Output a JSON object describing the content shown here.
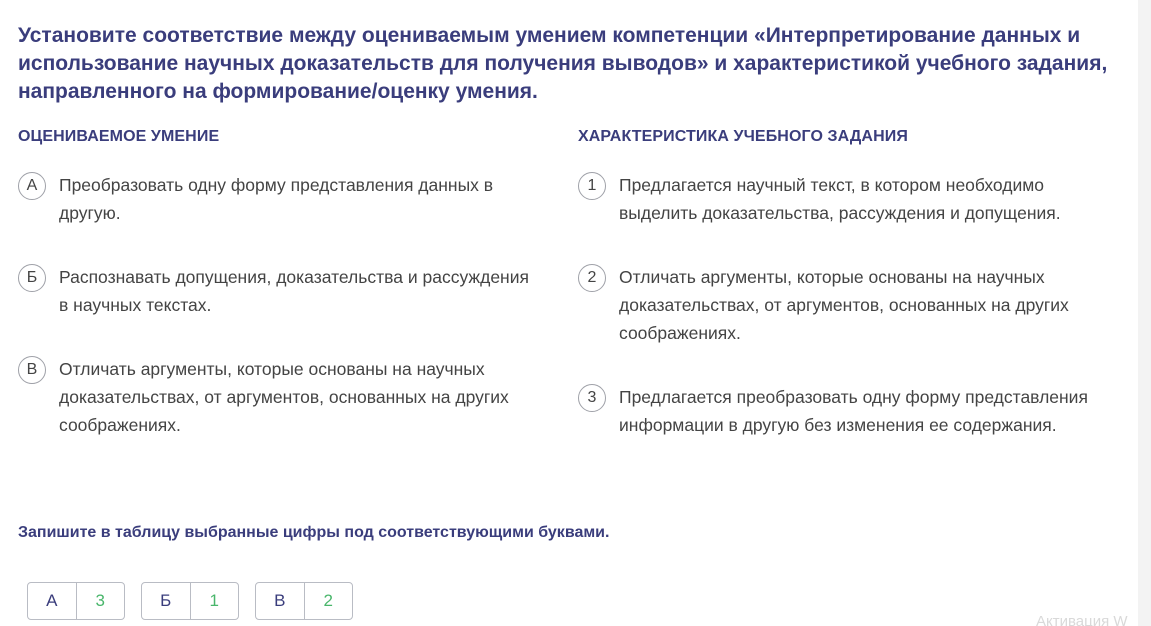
{
  "question": "Установите соответствие между оцениваемым умением компетенции «Интерпретирование данных и использование научных доказательств для получения выводов» и характеристикой учебного задания, направленного на формирование/оценку умения.",
  "left_header": "ОЦЕНИВАЕМОЕ УМЕНИЕ",
  "right_header": "ХАРАКТЕРИСТИКА УЧЕБНОГО ЗАДАНИЯ",
  "left_items": [
    {
      "marker": "А",
      "text": "Преобразовать одну форму представления данных в другую."
    },
    {
      "marker": "Б",
      "text": "Распознавать допущения, доказательства и рассуждения в научных текстах."
    },
    {
      "marker": "В",
      "text": "Отличать аргументы, которые основаны на научных доказательствах, от аргументов, основанных на других соображениях."
    }
  ],
  "right_items": [
    {
      "marker": "1",
      "text": "Предлагается научный текст, в котором необходимо выделить доказательства, рассуждения и допущения."
    },
    {
      "marker": "2",
      "text": "Отличать аргументы, которые основаны на научных доказательствах, от аргументов, основанных на других соображениях."
    },
    {
      "marker": "3",
      "text": "Предлагается преобразовать одну форму представления информации в другую без изменения ее содержания."
    }
  ],
  "instruction": "Запишите в таблицу выбранные цифры под соответствующими буквами.",
  "answers": [
    {
      "letter": "А",
      "digit": "3"
    },
    {
      "letter": "Б",
      "digit": "1"
    },
    {
      "letter": "В",
      "digit": "2"
    }
  ],
  "watermark": "Активация W",
  "colors": {
    "heading": "#3a3d7c",
    "digit": "#49b66b",
    "border": "#b9bcc4"
  }
}
